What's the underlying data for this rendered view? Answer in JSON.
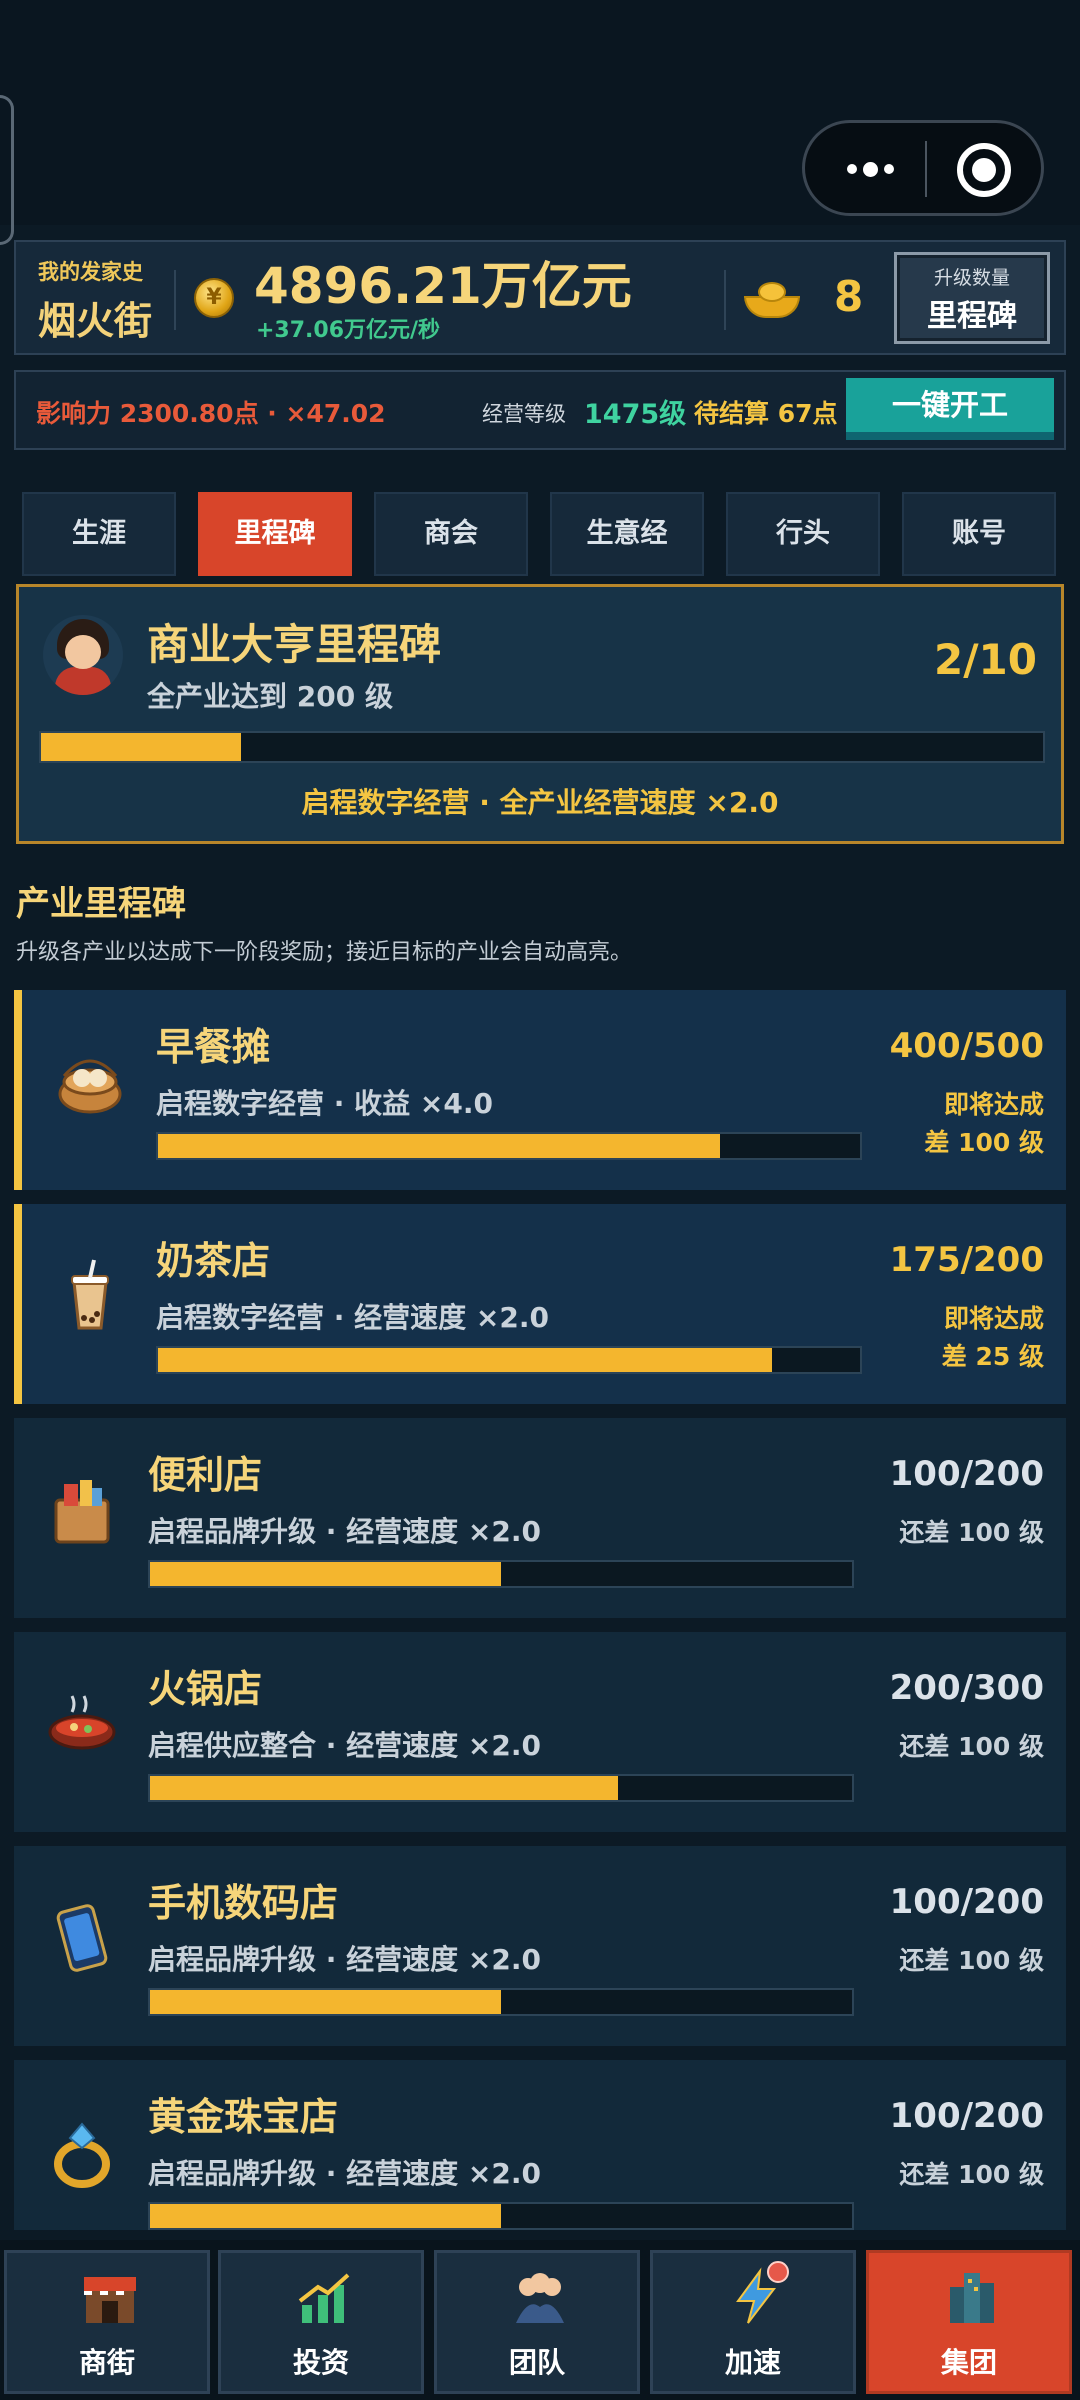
{
  "header": {
    "history_label": "我的发家史",
    "street_name": "烟火街",
    "money": "4896.21万亿元",
    "rate": "+37.06万亿元/秒",
    "ingot_count": "8",
    "upgrade_small": "升级数量",
    "upgrade_big": "里程碑"
  },
  "status": {
    "influence": "影响力 2300.80点 · ×47.02",
    "level_label": "经营等级",
    "level_value": "1475级",
    "pending": "待结算 67点",
    "one_click": "一键开工"
  },
  "tabs": [
    {
      "label": "生涯",
      "active": false
    },
    {
      "label": "里程碑",
      "active": true
    },
    {
      "label": "商会",
      "active": false
    },
    {
      "label": "生意经",
      "active": false
    },
    {
      "label": "行头",
      "active": false
    },
    {
      "label": "账号",
      "active": false
    }
  ],
  "main_milestone": {
    "title": "商业大亨里程碑",
    "subtitle": "全产业达到 200 级",
    "count": "2/10",
    "progress": 0.2,
    "reward": "启程数字经营 · 全产业经营速度 ×2.0"
  },
  "section": {
    "title": "产业里程碑",
    "subtitle": "升级各产业以达成下一阶段奖励；接近目标的产业会自动高亮。"
  },
  "industries": [
    {
      "name": "早餐摊",
      "desc": "启程数字经营 · 收益 ×4.0",
      "count": "400/500",
      "progress": 0.8,
      "status_line1": "即将达成",
      "status_line2": "差 100 级",
      "near": true,
      "icon": "breakfast-basket-icon"
    },
    {
      "name": "奶茶店",
      "desc": "启程数字经营 · 经营速度 ×2.0",
      "count": "175/200",
      "progress": 0.875,
      "status_line1": "即将达成",
      "status_line2": "差 25 级",
      "near": true,
      "icon": "milk-tea-icon"
    },
    {
      "name": "便利店",
      "desc": "启程品牌升级 · 经营速度 ×2.0",
      "count": "100/200",
      "progress": 0.5,
      "status_line1": "还差 100 级",
      "status_line2": "",
      "near": false,
      "icon": "shopping-bag-icon"
    },
    {
      "name": "火锅店",
      "desc": "启程供应整合 · 经营速度 ×2.0",
      "count": "200/300",
      "progress": 0.667,
      "status_line1": "还差 100 级",
      "status_line2": "",
      "near": false,
      "icon": "hotpot-icon"
    },
    {
      "name": "手机数码店",
      "desc": "启程品牌升级 · 经营速度 ×2.0",
      "count": "100/200",
      "progress": 0.5,
      "status_line1": "还差 100 级",
      "status_line2": "",
      "near": false,
      "icon": "smartphone-icon"
    },
    {
      "name": "黄金珠宝店",
      "desc": "启程品牌升级 · 经营速度 ×2.0",
      "count": "100/200",
      "progress": 0.5,
      "status_line1": "还差 100 级",
      "status_line2": "",
      "near": false,
      "icon": "ring-icon"
    }
  ],
  "nav": [
    {
      "label": "商街",
      "icon": "storefront-icon",
      "active": false,
      "badge": false
    },
    {
      "label": "投资",
      "icon": "growth-chart-icon",
      "active": false,
      "badge": false
    },
    {
      "label": "团队",
      "icon": "team-icon",
      "active": false,
      "badge": false
    },
    {
      "label": "加速",
      "icon": "lightning-icon",
      "active": false,
      "badge": true
    },
    {
      "label": "集团",
      "icon": "skyscraper-icon",
      "active": true,
      "badge": false
    }
  ],
  "colors": {
    "background": "#0c1a25",
    "accent_gold": "#f4c542",
    "accent_red": "#d8452a",
    "accent_teal": "#19a29a",
    "progress_fill": "#f4b62e"
  }
}
